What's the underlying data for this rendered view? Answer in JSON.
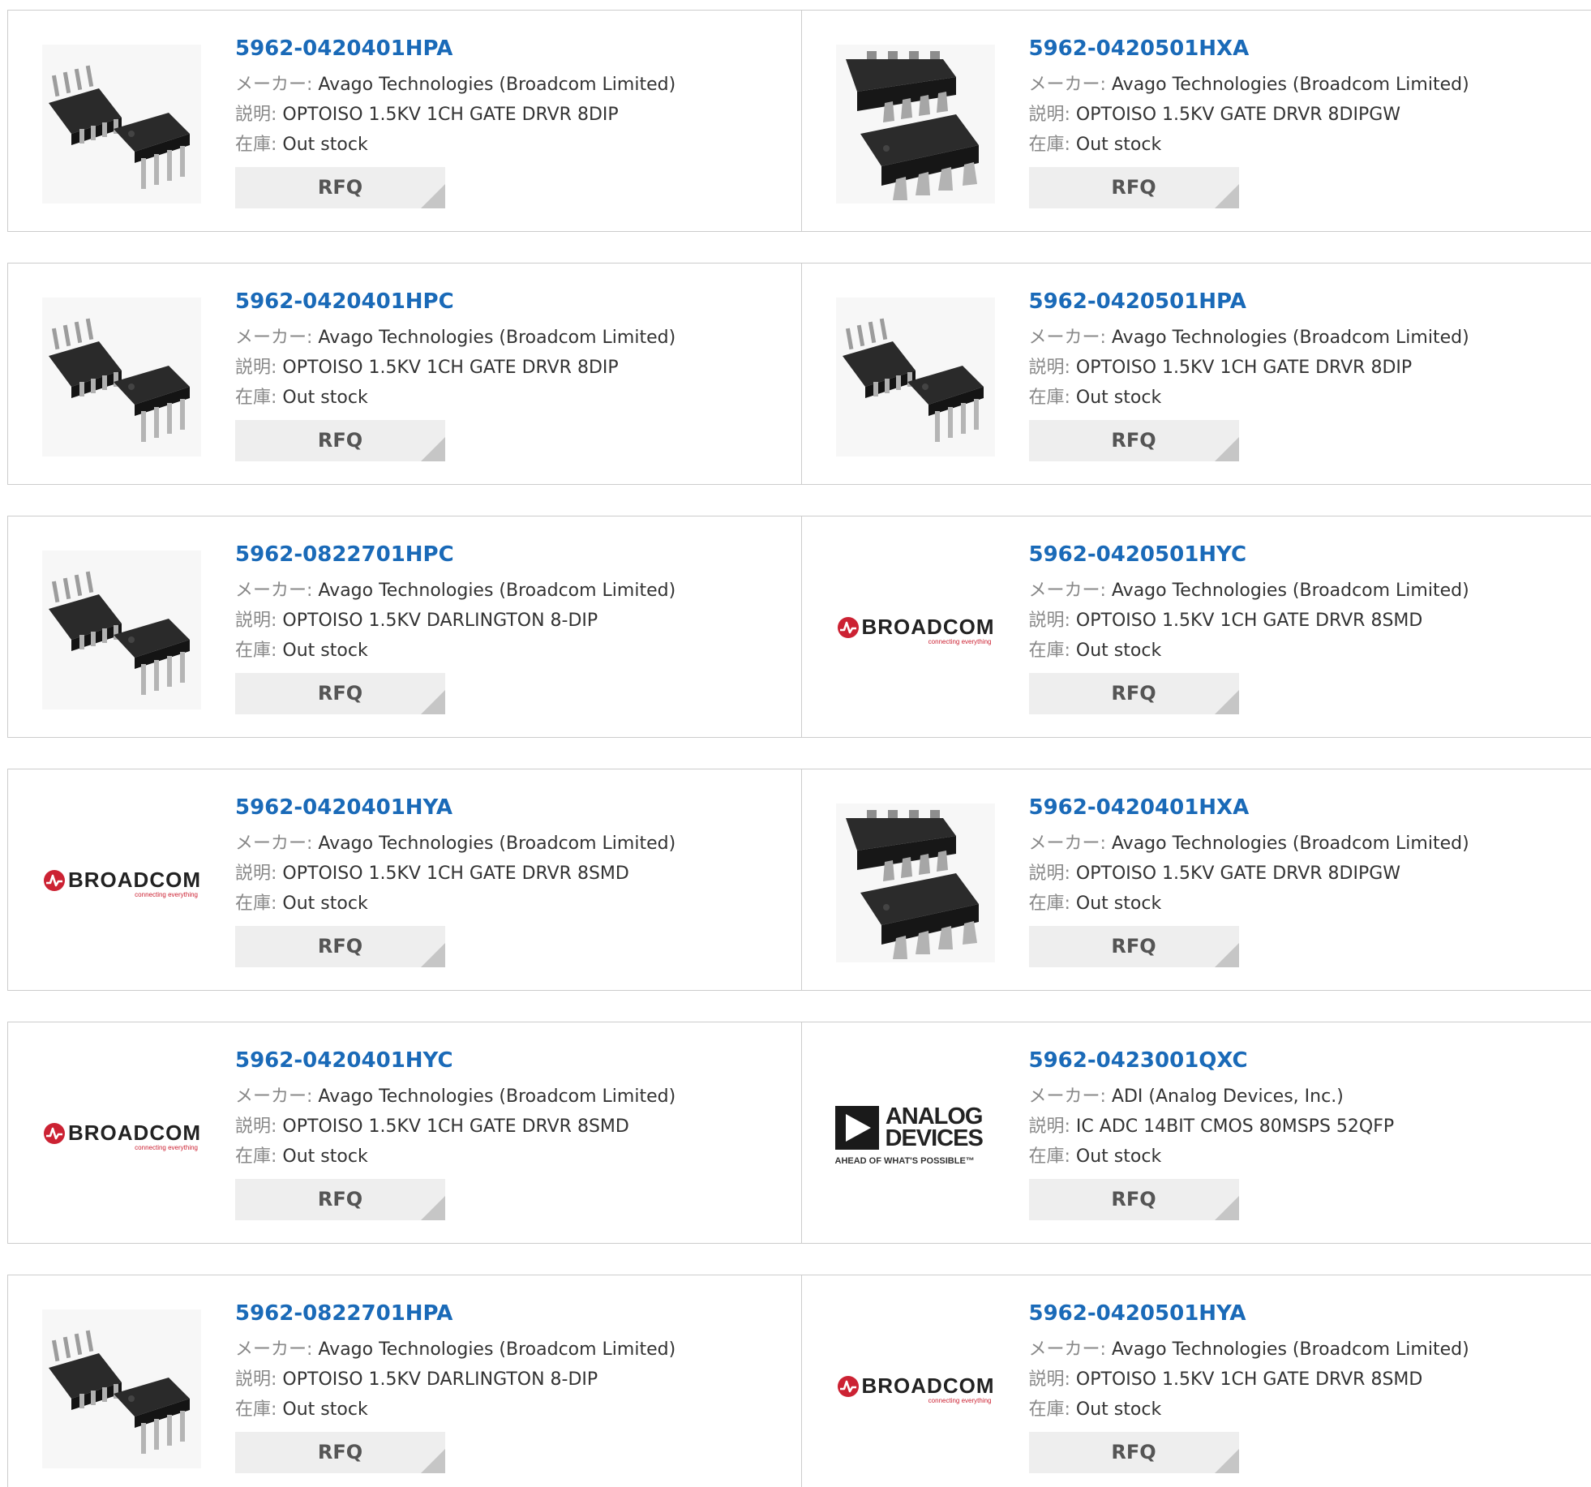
{
  "labels": {
    "manufacturer": "メーカー:",
    "description": "説明:",
    "stock": "在庫:",
    "rfq": "RFQ"
  },
  "images": {
    "dip8": "8-pin DIP optocoupler package photo",
    "dipgw": "8-pin DIP gull-wing package photo",
    "broadcom": {
      "name": "BROADCOM",
      "tagline": "connecting everything"
    },
    "adi": {
      "name_line1": "ANALOG",
      "name_line2": "DEVICES",
      "tagline": "AHEAD OF WHAT'S POSSIBLE™"
    }
  },
  "colors": {
    "part_link": "#1a6ab8",
    "label": "#888888",
    "border": "#cccccc",
    "rfq_bg": "#eeeeee",
    "broadcom_red": "#cc2233"
  },
  "products": [
    {
      "part": "5962-0420401HPA",
      "image": "dip8",
      "manufacturer": "Avago Technologies (Broadcom Limited)",
      "description": "OPTOISO 1.5KV 1CH GATE DRVR 8DIP",
      "stock": "Out stock"
    },
    {
      "part": "5962-0420501HXA",
      "image": "dipgw",
      "manufacturer": "Avago Technologies (Broadcom Limited)",
      "description": "OPTOISO 1.5KV GATE DRVR 8DIPGW",
      "stock": "Out stock"
    },
    {
      "part": "5962-0420401HPC",
      "image": "dip8",
      "manufacturer": "Avago Technologies (Broadcom Limited)",
      "description": "OPTOISO 1.5KV 1CH GATE DRVR 8DIP",
      "stock": "Out stock"
    },
    {
      "part": "5962-0420501HPA",
      "image": "dip8",
      "manufacturer": "Avago Technologies (Broadcom Limited)",
      "description": "OPTOISO 1.5KV 1CH GATE DRVR 8DIP",
      "stock": "Out stock"
    },
    {
      "part": "5962-0822701HPC",
      "image": "dip8",
      "manufacturer": "Avago Technologies (Broadcom Limited)",
      "description": "OPTOISO 1.5KV DARLINGTON 8-DIP",
      "stock": "Out stock"
    },
    {
      "part": "5962-0420501HYC",
      "image": "broadcom",
      "manufacturer": "Avago Technologies (Broadcom Limited)",
      "description": "OPTOISO 1.5KV 1CH GATE DRVR 8SMD",
      "stock": "Out stock"
    },
    {
      "part": "5962-0420401HYA",
      "image": "broadcom",
      "manufacturer": "Avago Technologies (Broadcom Limited)",
      "description": "OPTOISO 1.5KV 1CH GATE DRVR 8SMD",
      "stock": "Out stock"
    },
    {
      "part": "5962-0420401HXA",
      "image": "dipgw",
      "manufacturer": "Avago Technologies (Broadcom Limited)",
      "description": "OPTOISO 1.5KV GATE DRVR 8DIPGW",
      "stock": "Out stock"
    },
    {
      "part": "5962-0420401HYC",
      "image": "broadcom",
      "manufacturer": "Avago Technologies (Broadcom Limited)",
      "description": "OPTOISO 1.5KV 1CH GATE DRVR 8SMD",
      "stock": "Out stock"
    },
    {
      "part": "5962-0423001QXC",
      "image": "adi",
      "manufacturer": "ADI (Analog Devices, Inc.)",
      "description": "IC ADC 14BIT CMOS 80MSPS 52QFP",
      "stock": "Out stock"
    },
    {
      "part": "5962-0822701HPA",
      "image": "dip8",
      "manufacturer": "Avago Technologies (Broadcom Limited)",
      "description": "OPTOISO 1.5KV DARLINGTON 8-DIP",
      "stock": "Out stock"
    },
    {
      "part": "5962-0420501HYA",
      "image": "broadcom",
      "manufacturer": "Avago Technologies (Broadcom Limited)",
      "description": "OPTOISO 1.5KV 1CH GATE DRVR 8SMD",
      "stock": "Out stock"
    }
  ]
}
